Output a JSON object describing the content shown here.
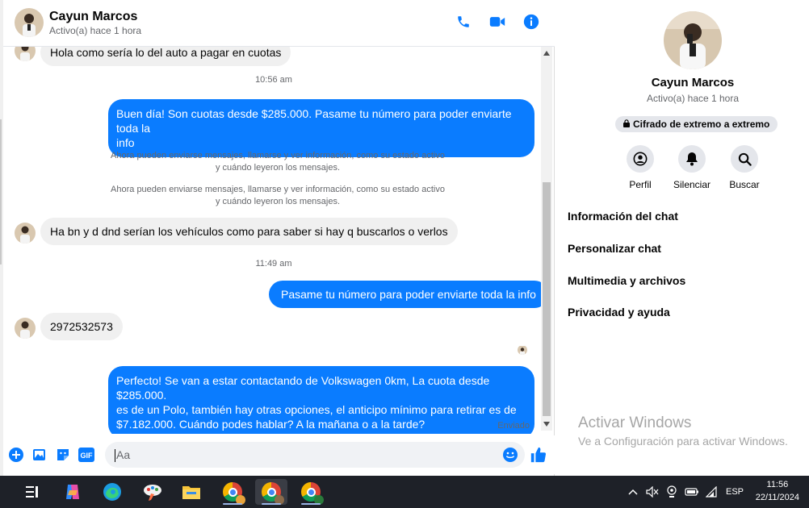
{
  "contact": {
    "name": "Cayun Marcos",
    "status": "Activo(a) hace 1 hora"
  },
  "header_icons": [
    "phone-icon",
    "video-icon",
    "info-icon"
  ],
  "colors": {
    "accent": "#0a7cff",
    "incoming_bubble": "#f0f0f0",
    "taskbar": "#1e2128"
  },
  "messages": {
    "m0": "Hola como sería lo del auto a pagar en cuotas",
    "t1": "10:56 am",
    "m1_line1": "Buen día! Son cuotas desde $285.000. Pasame tu número para poder enviarte toda la",
    "m1_line2": "info",
    "sys1_line1": "Ahora pueden enviarse mensajes, llamarse y ver información, como su estado activo",
    "sys1_line2": "y cuándo leyeron los mensajes.",
    "sys2_line1": "Ahora pueden enviarse mensajes, llamarse y ver información, como su estado activo",
    "sys2_line2": "y cuándo leyeron los mensajes.",
    "m2": "Ha bn y d dnd serían los vehículos como para saber si hay q buscarlos o verlos",
    "t2": "11:49 am",
    "m3": "Pasame tu número para poder enviarte toda la info",
    "m4": "2972532573",
    "m5_line1": "Perfecto!  Se van a estar contactando de Volkswagen 0km, La cuota desde $285.000.",
    "m5_line2": "es de un Polo, también hay otras opciones, el anticipo mínimo para retirar es de",
    "m5_line3": "$7.182.000. Cuándo podes hablar? A la mañana o a la tarde?",
    "sent_label": "Enviado"
  },
  "composer": {
    "placeholder": "Aa",
    "gif_label": "GIF"
  },
  "info_panel": {
    "name": "Cayun Marcos",
    "status": "Activo(a) hace 1 hora",
    "encryption": "Cifrado de extremo a extremo",
    "actions": {
      "profile": "Perfil",
      "mute": "Silenciar",
      "search": "Buscar"
    },
    "menu": [
      "Información del chat",
      "Personalizar chat",
      "Multimedia y archivos",
      "Privacidad y ayuda"
    ]
  },
  "watermark": {
    "title": "Activar Windows",
    "subtitle": "Ve a Configuración para activar Windows."
  },
  "taskbar": {
    "language": "ESP",
    "time": "11:56",
    "date": "22/11/2024"
  }
}
